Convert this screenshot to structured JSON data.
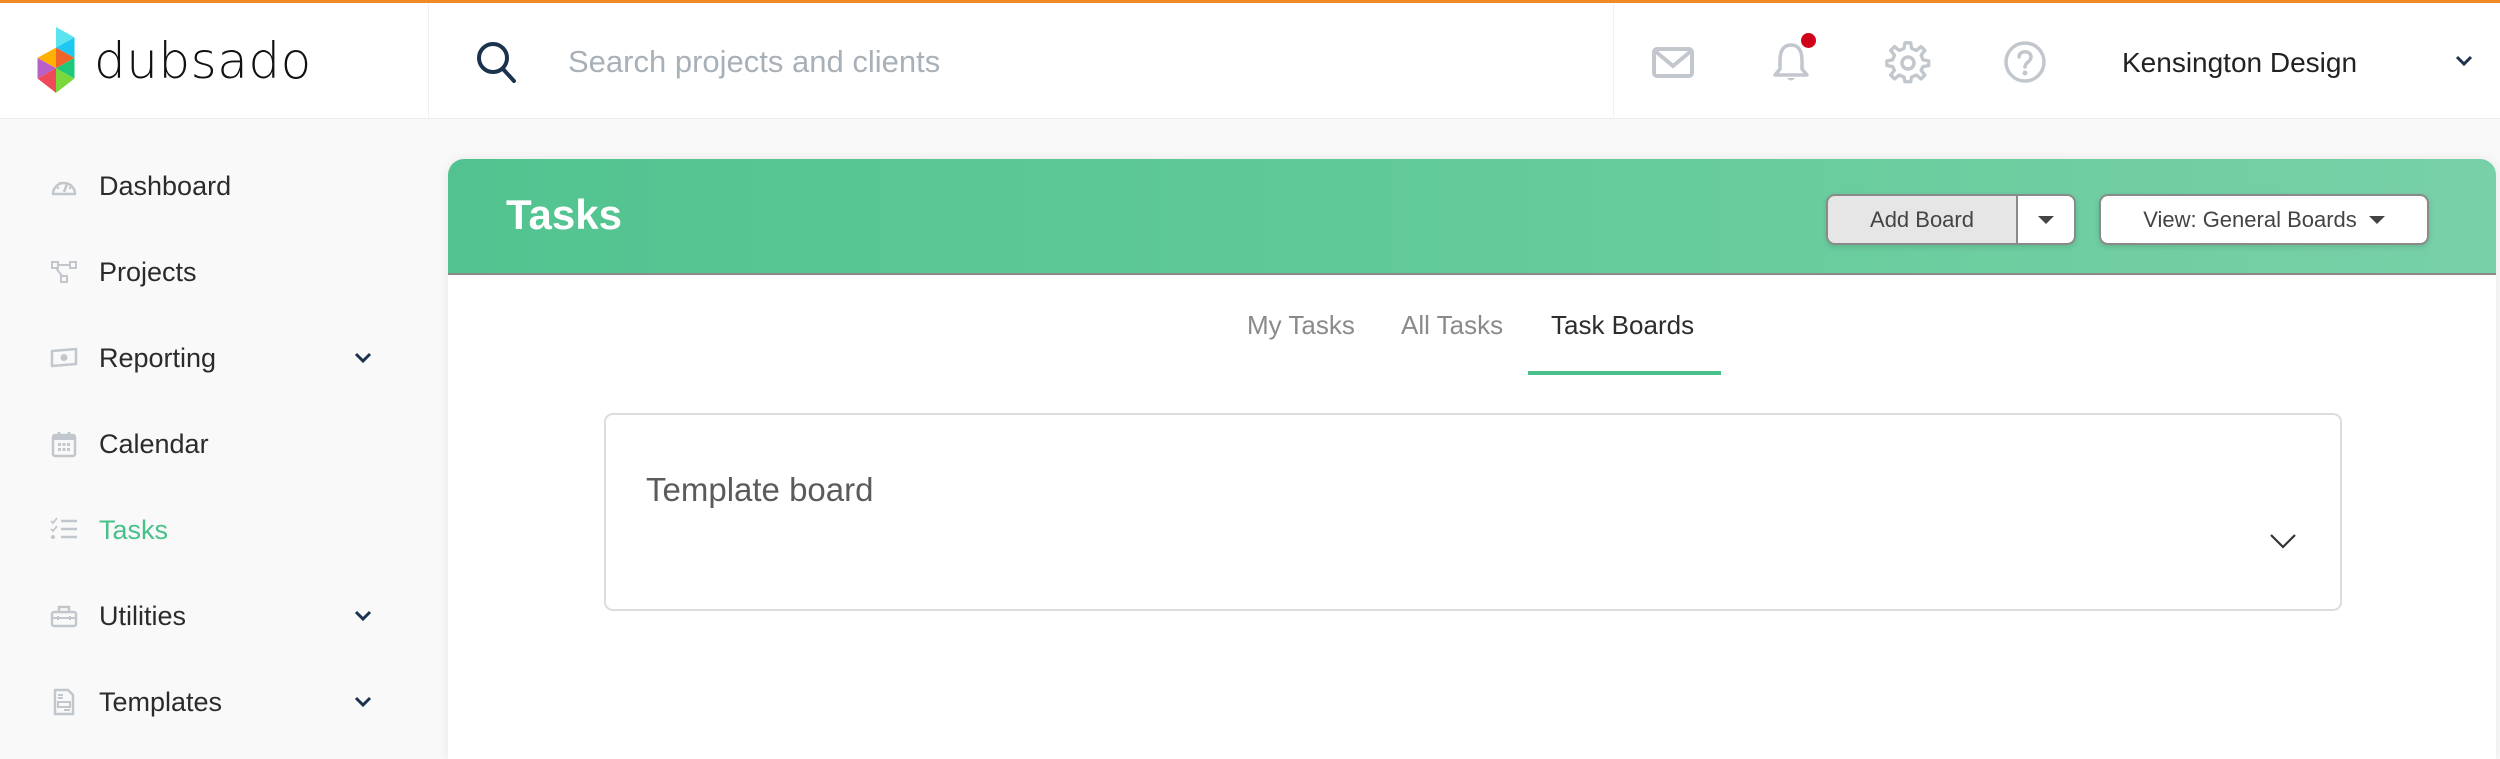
{
  "brand": {
    "name": "dubsado",
    "accent_color": "#f08a24",
    "green": "#48c08a"
  },
  "header": {
    "search": {
      "placeholder": "Search projects and clients",
      "value": ""
    },
    "icons": [
      "mail-icon",
      "bell-icon",
      "gear-icon",
      "help-icon"
    ],
    "notification_badge": true,
    "account": {
      "name": "Kensington Design"
    }
  },
  "sidebar": {
    "items": [
      {
        "label": "Dashboard",
        "icon": "dashboard-icon",
        "has_chevron": false,
        "active": false
      },
      {
        "label": "Projects",
        "icon": "projects-icon",
        "has_chevron": false,
        "active": false
      },
      {
        "label": "Reporting",
        "icon": "reporting-icon",
        "has_chevron": true,
        "active": false
      },
      {
        "label": "Calendar",
        "icon": "calendar-icon",
        "has_chevron": false,
        "active": false
      },
      {
        "label": "Tasks",
        "icon": "tasks-icon",
        "has_chevron": false,
        "active": true
      },
      {
        "label": "Utilities",
        "icon": "utilities-icon",
        "has_chevron": true,
        "active": false
      },
      {
        "label": "Templates",
        "icon": "templates-icon",
        "has_chevron": true,
        "active": false
      }
    ]
  },
  "main": {
    "title": "Tasks",
    "add_board_label": "Add Board",
    "view_label": "View: General Boards",
    "tabs": [
      {
        "label": "My Tasks",
        "active": false
      },
      {
        "label": "All Tasks",
        "active": false
      },
      {
        "label": "Task Boards",
        "active": true
      }
    ],
    "boards": [
      {
        "title": "Template board"
      }
    ]
  }
}
